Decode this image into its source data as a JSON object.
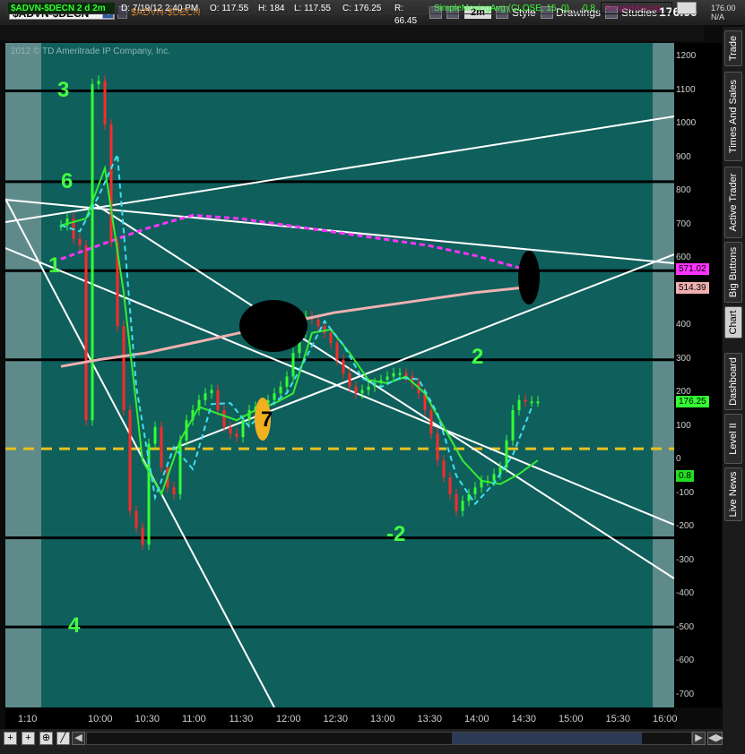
{
  "header": {
    "symbol": "$ADVN-$DECN",
    "title": "$ADVN-$DECN",
    "aggregation": "2m",
    "style": "Style",
    "drawings": "Drawings",
    "studies": "Studies",
    "last_price": "176.00",
    "quote_top": "176.00",
    "quote_bottom": "N/A"
  },
  "study_bar": {
    "name": "$ADVN-$DECN 2 d 2m",
    "date": "D: 7/19/12 2:40 PM",
    "open": "O: 117.55",
    "high": "H: 184",
    "low": "L: 117.55",
    "close": "C: 176.25",
    "range": "R: 66.45",
    "sma": "SimpleMovingAvg (CLOSE, 15, 0)",
    "sma_value": "0.8",
    "sma2": "SimpleMoving"
  },
  "copyright": "2012 © TD Ameritrade IP Company, Inc.",
  "side_tabs": [
    "Trade",
    "Times And Sales",
    "Active Trader",
    "Big Buttons",
    "Chart",
    "Dashboard",
    "Level II",
    "Live News"
  ],
  "chart_data": {
    "type": "line",
    "title": "$ADVN-$DECN",
    "ylim": [
      -750,
      1250
    ],
    "y_ticks": [
      "1200",
      "1100",
      "1000",
      "900",
      "800",
      "700",
      "600",
      "500",
      "400",
      "300",
      "200",
      "100",
      "0",
      "-100",
      "-200",
      "-300",
      "-400",
      "-500",
      "-600",
      "-700"
    ],
    "x_ticks": [
      "1:10",
      "10:00",
      "10:30",
      "11:00",
      "11:30",
      "12:00",
      "12:30",
      "13:00",
      "13:30",
      "14:00",
      "14:30",
      "15:00",
      "15:30",
      "16:00"
    ],
    "price_labels": [
      "571.02",
      "514.39",
      "176.25",
      "0.8"
    ],
    "horizontal_levels": [
      1100,
      830,
      565,
      300,
      35,
      -230,
      -495
    ],
    "dashed_level": 35,
    "annotations": [
      "3",
      "6",
      "1",
      "7",
      "2",
      "-2",
      "4"
    ],
    "close_series": {
      "x": [
        "9:36",
        "9:40",
        "9:44",
        "9:48",
        "9:52",
        "9:56",
        "10:00",
        "10:04",
        "10:08",
        "10:12",
        "10:16",
        "10:20",
        "10:24",
        "10:28",
        "10:32",
        "10:36",
        "10:40",
        "10:44",
        "10:48",
        "10:52",
        "10:56",
        "11:00",
        "11:04",
        "11:08",
        "11:12",
        "11:16",
        "11:20",
        "11:24",
        "11:28",
        "11:32",
        "11:36",
        "11:40",
        "11:44",
        "11:48",
        "11:52",
        "11:56",
        "12:00",
        "12:04",
        "12:08",
        "12:12",
        "12:16",
        "12:20",
        "12:24",
        "12:28",
        "12:32",
        "12:36",
        "12:40",
        "12:44",
        "12:48",
        "12:52",
        "12:56",
        "13:00",
        "13:04",
        "13:08",
        "13:12",
        "13:16",
        "13:20",
        "13:24",
        "13:28",
        "13:32",
        "13:36",
        "13:40",
        "13:44",
        "13:48",
        "13:52",
        "13:56",
        "14:00",
        "14:04",
        "14:08",
        "14:12",
        "14:16",
        "14:20",
        "14:24",
        "14:28",
        "14:32",
        "14:36",
        "14:40"
      ],
      "values": [
        700,
        720,
        660,
        640,
        120,
        1120,
        1130,
        1000,
        650,
        400,
        150,
        -150,
        -200,
        -250,
        50,
        100,
        -20,
        -80,
        -100,
        60,
        120,
        150,
        180,
        200,
        210,
        150,
        100,
        80,
        70,
        120,
        150,
        160,
        170,
        180,
        200,
        220,
        250,
        320,
        380,
        430,
        420,
        400,
        380,
        350,
        300,
        260,
        220,
        200,
        210,
        220,
        230,
        240,
        250,
        260,
        260,
        250,
        230,
        200,
        150,
        80,
        0,
        -50,
        -100,
        -150,
        -120,
        -100,
        -80,
        -60,
        -60,
        -40,
        -20,
        60,
        150,
        180,
        176,
        176,
        176
      ]
    },
    "sma_series": {
      "x": [
        "9:36",
        "9:52",
        "10:04",
        "10:16",
        "10:28",
        "10:40",
        "10:52",
        "11:04",
        "11:16",
        "11:28",
        "11:40",
        "11:52",
        "12:04",
        "12:16",
        "12:28",
        "12:40",
        "12:52",
        "13:04",
        "13:16",
        "13:28",
        "13:40",
        "13:52",
        "14:04",
        "14:16",
        "14:28",
        "14:40"
      ],
      "values": [
        700,
        720,
        870,
        500,
        0,
        -100,
        60,
        160,
        140,
        120,
        150,
        170,
        200,
        380,
        390,
        320,
        240,
        230,
        250,
        200,
        100,
        0,
        -60,
        -70,
        -40,
        0.8
      ]
    },
    "long_ma_series": {
      "x": [
        "9:36",
        "10:00",
        "10:30",
        "11:00",
        "11:30",
        "12:00",
        "12:30",
        "13:00",
        "13:30",
        "14:00",
        "14:30"
      ],
      "values": [
        600,
        640,
        690,
        730,
        720,
        700,
        680,
        660,
        640,
        610,
        571.02
      ]
    },
    "longer_ma_series": {
      "x": [
        "9:36",
        "10:00",
        "10:30",
        "11:00",
        "11:30",
        "12:00",
        "12:30",
        "13:00",
        "13:30",
        "14:00",
        "14:30"
      ],
      "values": [
        280,
        300,
        320,
        350,
        380,
        410,
        440,
        460,
        480,
        500,
        514.39
      ]
    }
  },
  "colors": {
    "background": "#0f5f5c",
    "up": "#33ff33",
    "down": "#ff2a2a",
    "sma": "#33ee33",
    "ma_dashed": "#40e0f0",
    "ma_magenta": "#ff33ff",
    "ma_pink": "#f0b0b0",
    "level_dashed": "#e8c020"
  }
}
